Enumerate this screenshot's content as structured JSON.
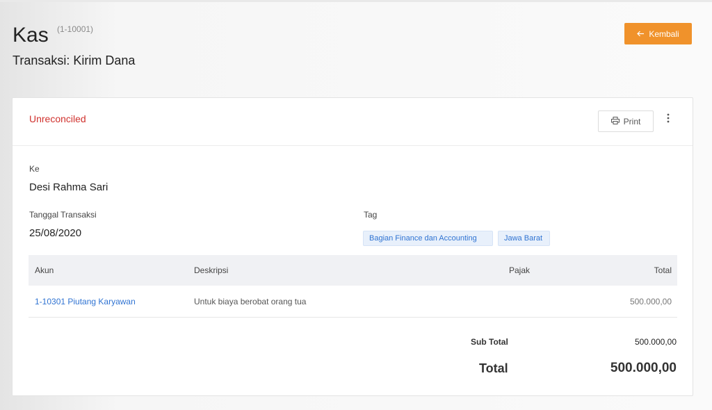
{
  "header": {
    "title": "Kas",
    "code": "(1-10001)",
    "subtitle": "Transaksi: Kirim Dana",
    "back_label": "Kembali"
  },
  "card": {
    "status": "Unreconciled",
    "print_label": "Print",
    "to_label": "Ke",
    "to_value": "Desi Rahma Sari",
    "date_label": "Tanggal Transaksi",
    "date_value": "25/08/2020",
    "tag_label": "Tag",
    "tags": [
      "Bagian Finance dan Accounting",
      "Jawa Barat"
    ]
  },
  "table": {
    "columns": [
      "Akun",
      "Deskripsi",
      "Pajak",
      "Total"
    ],
    "rows": [
      {
        "akun": "1-10301 Piutang Karyawan",
        "deskripsi": "Untuk biaya berobat orang tua",
        "pajak": "",
        "total": "500.000,00"
      }
    ]
  },
  "summary": {
    "subtotal_label": "Sub Total",
    "subtotal_value": "500.000,00",
    "total_label": "Total",
    "total_value": "500.000,00"
  },
  "icons": {
    "back": "arrow-left-icon",
    "print": "printer-icon",
    "more": "more-vertical-icon"
  },
  "colors": {
    "accent": "#f0922b",
    "status": "#d0312d",
    "link": "#2f73d2"
  }
}
